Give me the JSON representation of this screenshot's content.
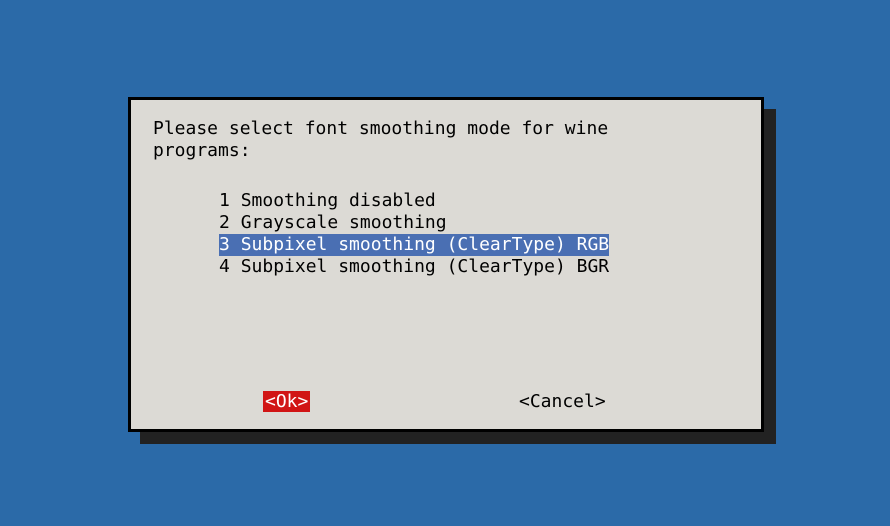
{
  "dialog": {
    "prompt_line1": "Please select font smoothing mode for wine",
    "prompt_line2": "programs:",
    "options": [
      {
        "num": "1",
        "label": "Smoothing disabled",
        "selected": false
      },
      {
        "num": "2",
        "label": "Grayscale smoothing",
        "selected": false
      },
      {
        "num": "3",
        "label": "Subpixel smoothing (ClearType) RGB",
        "selected": true
      },
      {
        "num": "4",
        "label": "Subpixel smoothing (ClearType) BGR",
        "selected": false
      }
    ],
    "ok_label": "<Ok>",
    "cancel_label": "<Cancel>"
  }
}
